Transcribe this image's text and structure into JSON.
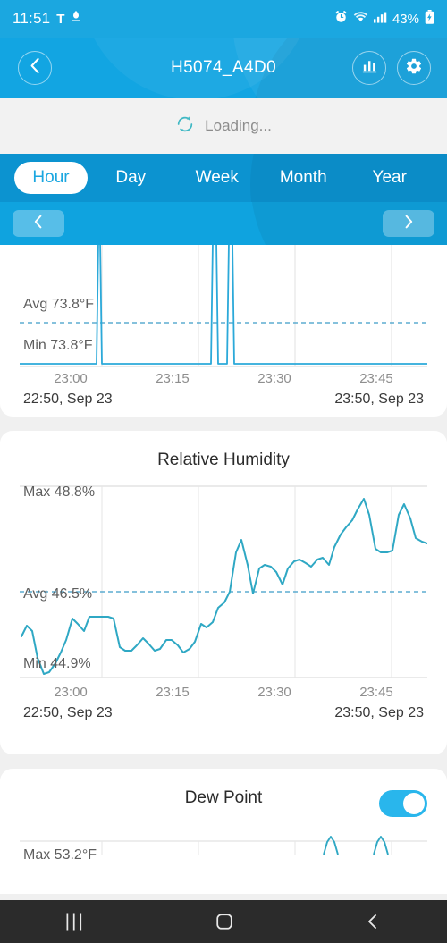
{
  "status_bar": {
    "time": "11:51",
    "carrier": "T",
    "battery_percent": "43%",
    "icons": [
      "alarm-icon",
      "wifi-icon",
      "signal-icon",
      "battery-charging-icon"
    ]
  },
  "header": {
    "title": "H5074_A4D0",
    "back_icon": "chevron-left-icon",
    "chart_icon": "bar-chart-icon",
    "settings_icon": "gear-icon"
  },
  "loading": {
    "label": "Loading...",
    "icon": "refresh-spinner-icon"
  },
  "range_tabs": {
    "items": [
      {
        "label": "Hour",
        "active": true
      },
      {
        "label": "Day",
        "active": false
      },
      {
        "label": "Week",
        "active": false
      },
      {
        "label": "Month",
        "active": false
      },
      {
        "label": "Year",
        "active": false
      }
    ]
  },
  "pager": {
    "prev_icon": "chevron-left-icon",
    "next_icon": "chevron-right-icon"
  },
  "colors": {
    "header_blue": "#12A5E2",
    "tab_blue": "#0C93D0",
    "pager_blue": "#0FA3DF",
    "accent": "#29B6EC",
    "line_temperature": "#2BA9D9",
    "line_humidity": "#2FA8C4",
    "line_dewpoint": "#2FA8C4",
    "page_bg": "#F0F0F0",
    "card_bg": "#FFFFFF"
  },
  "cards": [
    {
      "id": "temperature",
      "title": "",
      "clipped": true,
      "stats": {
        "avg": "Avg 73.8°F",
        "min": "Min 73.8°F"
      },
      "x_ticks": [
        "23:00",
        "23:15",
        "23:30",
        "23:45"
      ],
      "range_start": "22:50, Sep 23",
      "range_end": "23:50, Sep 23"
    },
    {
      "id": "relative-humidity",
      "title": "Relative Humidity",
      "clipped": false,
      "stats": {
        "max": "Max 48.8%",
        "avg": "Avg 46.5%",
        "min": "Min 44.9%"
      },
      "x_ticks": [
        "23:00",
        "23:15",
        "23:30",
        "23:45"
      ],
      "range_start": "22:50, Sep 23",
      "range_end": "23:50, Sep 23"
    },
    {
      "id": "dew-point",
      "title": "Dew Point",
      "clipped": false,
      "toggle_on": true,
      "stats": {
        "max": "Max 53.2°F"
      }
    }
  ],
  "nav_bar": {
    "recents_icon": "recents-icon",
    "home_icon": "home-circle-icon",
    "back_icon": "back-chevron-icon"
  },
  "chart_data": [
    {
      "type": "line",
      "title": "Temperature",
      "ylabel": "°F",
      "xlabel": "",
      "unit": "°F",
      "max": null,
      "avg": 73.8,
      "min": 73.8,
      "avg_label": "Avg 73.8°F",
      "min_label": "Min 73.8°F",
      "x_ticks": [
        "23:00",
        "23:15",
        "23:30",
        "23:45"
      ],
      "range_start": "22:50, Sep 23",
      "range_end": "23:50, Sep 23",
      "grid": true,
      "note": "flat baseline with two narrow spikes clipped above the visible viewport",
      "points": [
        [
          0,
          0
        ],
        [
          18,
          0
        ],
        [
          20,
          100
        ],
        [
          22,
          100
        ],
        [
          23,
          0
        ],
        [
          56,
          0
        ],
        [
          57,
          100
        ],
        [
          60,
          100
        ],
        [
          61,
          0
        ],
        [
          64,
          0
        ],
        [
          65,
          100
        ],
        [
          67,
          100
        ],
        [
          68,
          0
        ],
        [
          100,
          0
        ]
      ]
    },
    {
      "type": "line",
      "title": "Relative Humidity",
      "ylabel": "%",
      "xlabel": "",
      "unit": "%",
      "max": 48.8,
      "avg": 46.5,
      "min": 44.9,
      "max_label": "Max 48.8%",
      "avg_label": "Avg 46.5%",
      "min_label": "Min 44.9%",
      "ylim": [
        44.9,
        48.8
      ],
      "x_ticks": [
        "23:00",
        "23:15",
        "23:30",
        "23:45"
      ],
      "range_start": "22:50, Sep 23",
      "range_end": "23:50, Sep 23",
      "grid": true,
      "x": [
        0,
        1.5,
        3,
        4.5,
        6,
        7.5,
        9,
        10.5,
        12,
        13.5,
        15,
        16.5,
        18,
        19.5,
        21,
        22.5,
        24,
        25.5,
        27,
        28.5,
        30,
        31.5,
        33,
        34.5,
        36,
        37.5,
        39,
        40.5,
        42,
        43.5,
        45,
        46.5,
        48,
        49.5,
        51,
        52.5,
        54,
        55.5,
        57,
        58.5,
        60,
        61.5,
        63,
        64.5,
        66,
        67.5,
        69,
        70.5,
        72,
        73.5,
        75,
        76.5,
        78,
        79.5,
        81,
        82.5,
        84,
        85.5,
        87,
        88.5,
        90,
        91.5,
        93,
        94.5,
        96,
        97.5,
        99,
        100
      ],
      "values": [
        45.2,
        45.5,
        45.3,
        44.9,
        44.9,
        45.0,
        45.1,
        45.3,
        45.6,
        46.0,
        45.9,
        45.7,
        46.0,
        46.0,
        46.0,
        45.9,
        45.3,
        45.2,
        45.2,
        45.3,
        45.2,
        45.4,
        45.3,
        45.2,
        45.4,
        45.4,
        45.3,
        45.2,
        45.3,
        45.5,
        45.8,
        45.7,
        45.8,
        46.1,
        46.2,
        46.5,
        47.1,
        47.4,
        46.8,
        46.4,
        47.0,
        47.1,
        47.0,
        46.8,
        47.0,
        47.2,
        47.2,
        47.1,
        47.0,
        47.2,
        47.3,
        47.2,
        47.1,
        47.4,
        47.8,
        47.9,
        48.1,
        48.2,
        48.5,
        48.8,
        48.4,
        47.7,
        47.7,
        48.0,
        48.5,
        48.1,
        47.8,
        47.8
      ]
    },
    {
      "type": "line",
      "title": "Dew Point",
      "ylabel": "°F",
      "unit": "°F",
      "max": 53.2,
      "max_label": "Max 53.2°F",
      "grid": true,
      "note": "only the topmost peaks of the curve are visible below the Max gridline",
      "peaks_x": [
        76,
        88
      ]
    }
  ]
}
